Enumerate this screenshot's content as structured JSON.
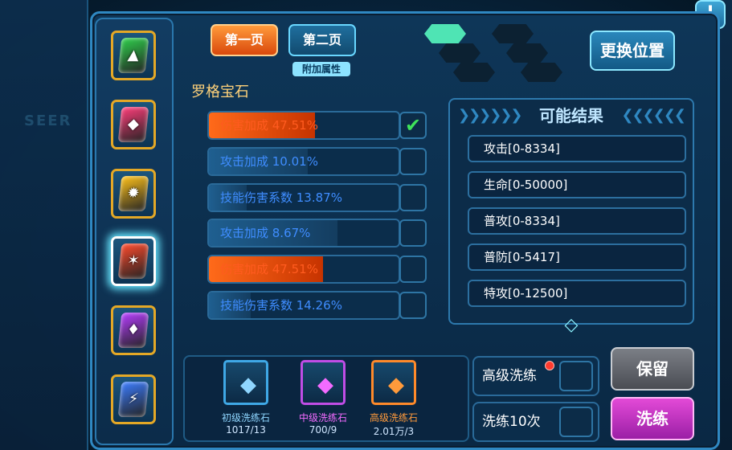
{
  "background": {
    "watermark": "SEER"
  },
  "alert_icon": "!",
  "tabs": {
    "page1": "第一页",
    "page2": "第二页",
    "extra_tag": "附加属性"
  },
  "swap_label": "更换位置",
  "gem_name": "罗格宝石",
  "gems": [
    {
      "name": "green-gem",
      "color": "#2fd04c",
      "symbol": "▲"
    },
    {
      "name": "pink-gem",
      "color": "#ff3d7a",
      "symbol": "◆"
    },
    {
      "name": "yellow-gem",
      "color": "#ffc21a",
      "symbol": "✹"
    },
    {
      "name": "red-gem",
      "color": "#ff4a2c",
      "symbol": "✶"
    },
    {
      "name": "purple-gem",
      "color": "#b63cff",
      "symbol": "♦"
    },
    {
      "name": "blue-gem",
      "color": "#3b7cff",
      "symbol": "⚡"
    }
  ],
  "attributes": [
    {
      "text": "伤害加成 47.51%",
      "fill": 0.56,
      "color": "#ff5a14",
      "text_color": "#ff5b1f",
      "checked": true
    },
    {
      "text": "攻击加成 10.01%",
      "fill": 0.52,
      "color": "#1c4f7a",
      "text_color": "#3f8dff",
      "checked": false
    },
    {
      "text": "技能伤害系数 13.87%",
      "fill": 0.2,
      "color": "#1c4f7a",
      "text_color": "#3f8dff",
      "checked": false
    },
    {
      "text": "攻击加成 8.67%",
      "fill": 0.68,
      "color": "#1c4f7a",
      "text_color": "#3f8dff",
      "checked": false
    },
    {
      "text": "伤害加成 47.51%",
      "fill": 0.6,
      "color": "#ff5a14",
      "text_color": "#ff5b1f",
      "checked": false
    },
    {
      "text": "技能伤害系数 14.26%",
      "fill": 0.22,
      "color": "#1c4f7a",
      "text_color": "#3f8dff",
      "checked": false
    }
  ],
  "results": {
    "title": "可能结果",
    "items": [
      "攻击[0-8334]",
      "生命[0-50000]",
      "普攻[0-8334]",
      "普防[0-5417]",
      "特攻[0-12500]"
    ]
  },
  "stones": [
    {
      "name": "初级洗练石",
      "count": "1017/13",
      "color": "#8fd6ff",
      "border": "#3fa8e6",
      "icon": "◆"
    },
    {
      "name": "中级洗练石",
      "count": "700/9",
      "color": "#f36bff",
      "border": "#c04de6",
      "icon": "◆"
    },
    {
      "name": "高级洗练石",
      "count": "2.01万/3",
      "color": "#ff9a3b",
      "border": "#ff8a2a",
      "icon": "◆"
    }
  ],
  "options": [
    {
      "label": "高级洗练"
    },
    {
      "label": "洗练10次"
    }
  ],
  "keep_label": "保留",
  "wash_label": "洗练"
}
